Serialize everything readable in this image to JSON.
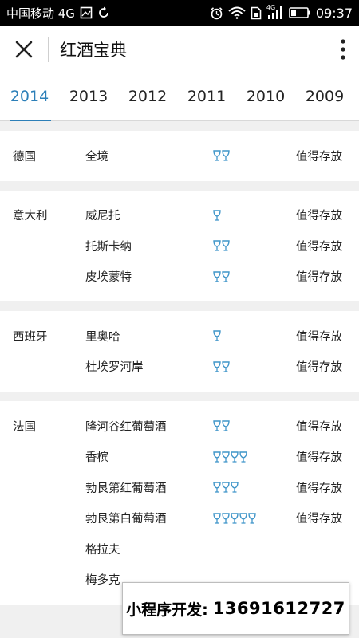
{
  "status_bar": {
    "carrier": "中国移动 4G",
    "time": "09:37",
    "network": "4G"
  },
  "appbar": {
    "title": "红酒宝典"
  },
  "tabs": [
    {
      "label": "2014",
      "active": true
    },
    {
      "label": "2013",
      "active": false
    },
    {
      "label": "2012",
      "active": false
    },
    {
      "label": "2011",
      "active": false
    },
    {
      "label": "2010",
      "active": false
    },
    {
      "label": "2009",
      "active": false
    }
  ],
  "groups": [
    {
      "country": "德国",
      "rows": [
        {
          "region": "全境",
          "glasses": 2,
          "status": "值得存放"
        }
      ]
    },
    {
      "country": "意大利",
      "rows": [
        {
          "region": "威尼托",
          "glasses": 1,
          "status": "值得存放"
        },
        {
          "region": "托斯卡纳",
          "glasses": 2,
          "status": "值得存放"
        },
        {
          "region": "皮埃蒙特",
          "glasses": 2,
          "status": "值得存放"
        }
      ]
    },
    {
      "country": "西班牙",
      "rows": [
        {
          "region": "里奥哈",
          "glasses": 1,
          "status": "值得存放"
        },
        {
          "region": "杜埃罗河岸",
          "glasses": 2,
          "status": "值得存放"
        }
      ]
    },
    {
      "country": "法国",
      "rows": [
        {
          "region": "隆河谷红葡萄酒",
          "glasses": 2,
          "status": "值得存放"
        },
        {
          "region": "香槟",
          "glasses": 4,
          "status": "值得存放"
        },
        {
          "region": "勃艮第红葡萄酒",
          "glasses": 3,
          "status": "值得存放"
        },
        {
          "region": "勃艮第白葡萄酒",
          "glasses": 5,
          "status": "值得存放"
        },
        {
          "region": "格拉夫",
          "glasses": 0,
          "status": ""
        },
        {
          "region": "梅多克",
          "glasses": 0,
          "status": ""
        }
      ]
    }
  ],
  "overlay": {
    "label": "小程序开发:",
    "phone": "13691612727"
  },
  "colors": {
    "accent": "#2c7fb8",
    "glass": "#3f95c9"
  }
}
